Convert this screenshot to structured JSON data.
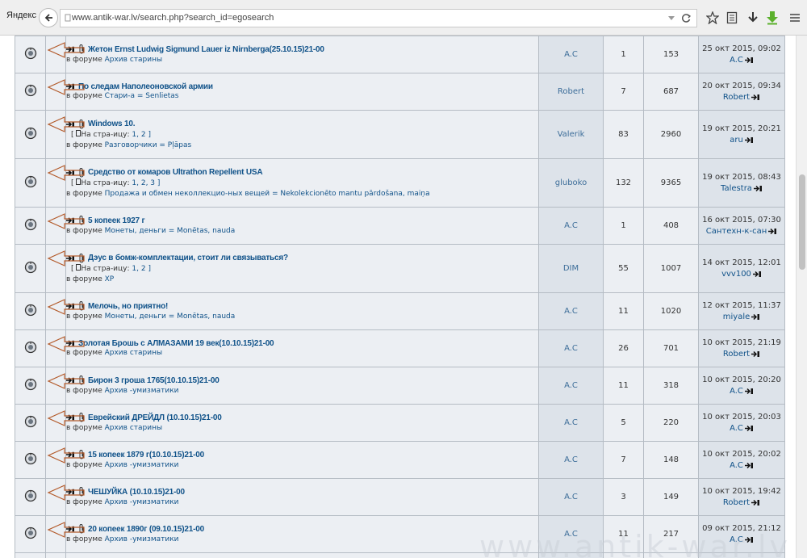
{
  "browser": {
    "brand": "Яндекс",
    "url": "www.antik-war.lv/search.php?search_id=egosearch"
  },
  "labels": {
    "in_forum": "в форуме",
    "pages_prefix": "На стра-ицу:"
  },
  "topics": [
    {
      "title": "Жетон Ernst Ludwig Sigmund Lauer iz Nirnberga(25.10.15)21-00",
      "forum": "Архив старины",
      "author": "A.C",
      "replies": "1",
      "views": "153",
      "last_date": "25 окт 2015, 09:02",
      "last_user": "A.C",
      "attach": true,
      "pages": ""
    },
    {
      "title": "По следам Наполеоновской армии",
      "forum": "Стари-а = Senlietas",
      "author": "Robert",
      "replies": "7",
      "views": "687",
      "last_date": "20 окт 2015, 09:34",
      "last_user": "Robert",
      "attach": false,
      "pages": ""
    },
    {
      "title": "Windows 10.",
      "forum": "Разговорчики = Pļāpas",
      "author": "Valerik",
      "replies": "83",
      "views": "2960",
      "last_date": "19 окт 2015, 20:21",
      "last_user": "aru",
      "attach": true,
      "pages": "1, 2 ]"
    },
    {
      "title": "Средство от комаров Ultrathon Repellent USA",
      "forum": "Продажа и обмен неколлекцио-ных вещей = Nekolekcionēto mantu pārdošana, maiņa",
      "author": "gluboko",
      "replies": "132",
      "views": "9365",
      "last_date": "19 окт 2015, 08:43",
      "last_user": "Talestra",
      "attach": true,
      "pages": "1, 2, 3 ]"
    },
    {
      "title": "5 копеек 1927 г",
      "forum": "Монеты, деньги = Monētas, nauda",
      "author": "A.C",
      "replies": "1",
      "views": "408",
      "last_date": "16 окт 2015, 07:30",
      "last_user": "Сантехн-к-сан",
      "attach": true,
      "pages": ""
    },
    {
      "title": "Дэус в бомж-комплектации, стоит ли связываться?",
      "forum": "XP",
      "author": "DIM",
      "replies": "55",
      "views": "1007",
      "last_date": "14 окт 2015, 12:01",
      "last_user": "vvv100",
      "attach": true,
      "pages": "1, 2 ]"
    },
    {
      "title": "Мелочь, но приятно!",
      "forum": "Монеты, деньги = Monētas, nauda",
      "author": "A.C",
      "replies": "11",
      "views": "1020",
      "last_date": "12 окт 2015, 11:37",
      "last_user": "miyale",
      "attach": true,
      "pages": ""
    },
    {
      "title": "Золотая Брошь с АЛМАЗАМИ 19 век(10.10.15)21-00",
      "forum": "Архив старины",
      "author": "A.C",
      "replies": "26",
      "views": "701",
      "last_date": "10 окт 2015, 21:19",
      "last_user": "Robert",
      "attach": false,
      "pages": ""
    },
    {
      "title": "Бирон 3 гроша 1765(10.10.15)21-00",
      "forum": "Архив -умизматики",
      "author": "A.C",
      "replies": "11",
      "views": "318",
      "last_date": "10 окт 2015, 20:20",
      "last_user": "A.C",
      "attach": true,
      "pages": ""
    },
    {
      "title": "Еврейский ДРЕЙДЛ (10.10.15)21-00",
      "forum": "Архив старины",
      "author": "A.C",
      "replies": "5",
      "views": "220",
      "last_date": "10 окт 2015, 20:03",
      "last_user": "A.C",
      "attach": true,
      "pages": ""
    },
    {
      "title": "15 копеек 1879 г(10.10.15)21-00",
      "forum": "Архив -умизматики",
      "author": "A.C",
      "replies": "7",
      "views": "148",
      "last_date": "10 окт 2015, 20:02",
      "last_user": "A.C",
      "attach": true,
      "pages": ""
    },
    {
      "title": "ЧЕШУЙКА (10.10.15)21-00",
      "forum": "Архив -умизматики",
      "author": "A.C",
      "replies": "3",
      "views": "149",
      "last_date": "10 окт 2015, 19:42",
      "last_user": "Robert",
      "attach": true,
      "pages": ""
    },
    {
      "title": "20 копеек 1890г (09.10.15)21-00",
      "forum": "Архив -умизматики",
      "author": "A.C",
      "replies": "11",
      "views": "217",
      "last_date": "09 окт 2015, 21:12",
      "last_user": "A.C",
      "attach": true,
      "pages": ""
    }
  ],
  "watermark": "www.antik-war.lv"
}
